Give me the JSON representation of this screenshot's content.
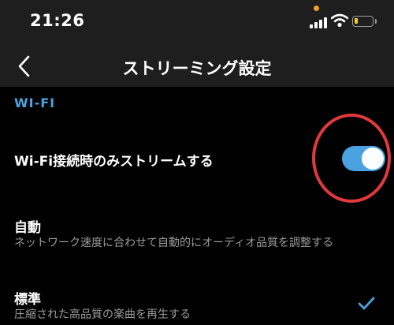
{
  "status_bar": {
    "time": "21:26",
    "icons": [
      "recording-dot-icon",
      "signal-icon",
      "wifi-icon",
      "battery-icon"
    ],
    "battery_color": "#f5cd27",
    "dot_color": "#f0a020"
  },
  "nav": {
    "back_icon": "chevron-left-icon",
    "title": "ストリーミング設定"
  },
  "section": {
    "header": "WI-FI"
  },
  "settings": {
    "wifi_only": {
      "label": "Wi-Fi接続時のみストリームする",
      "toggle_on": true,
      "toggle_color": "#4aa3e0",
      "highlight_color": "#e0393e"
    },
    "auto": {
      "label": "自動",
      "description": "ネットワーク速度に合わせて自動的にオーディオ品質を調整する"
    },
    "standard": {
      "label": "標準",
      "description": "圧縮された高品質の楽曲を再生する",
      "selected": true,
      "check_icon": "checkmark-icon"
    }
  }
}
